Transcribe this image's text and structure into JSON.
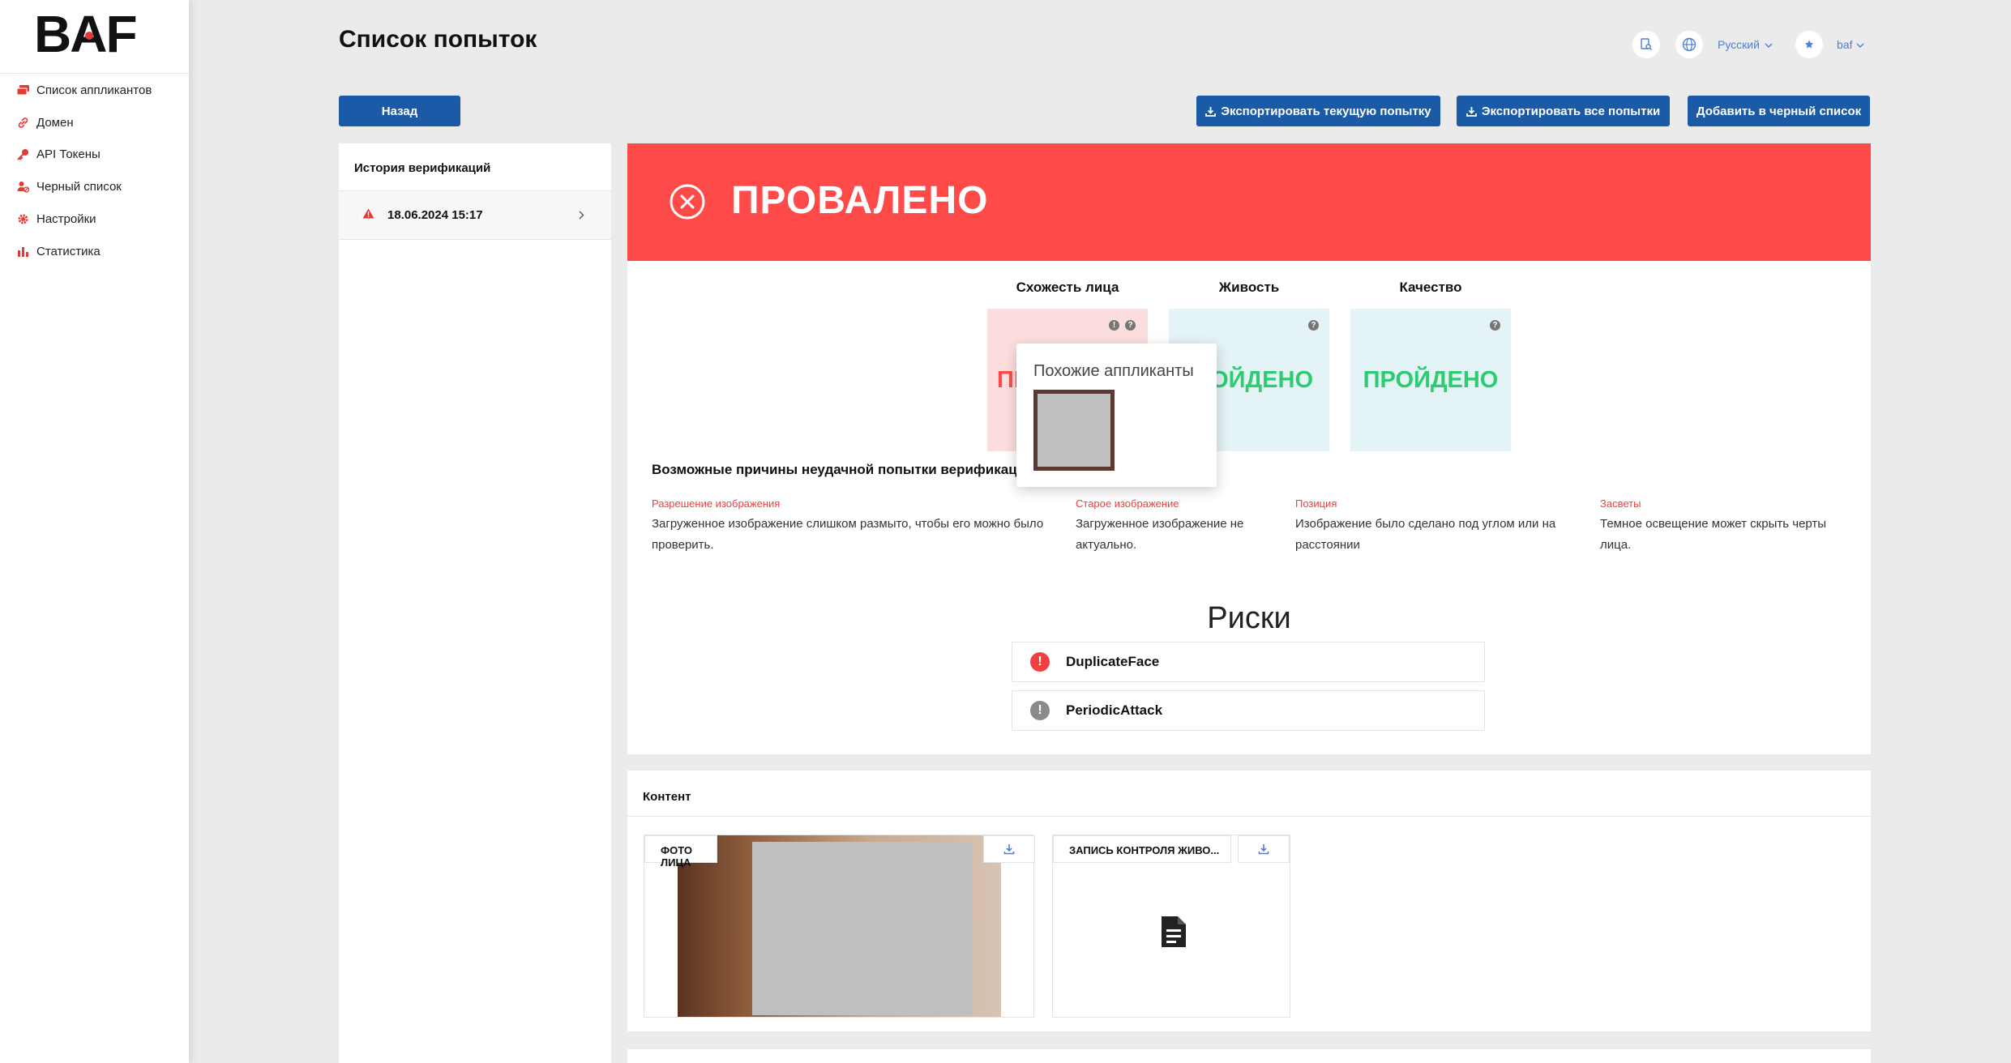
{
  "app": {
    "logo_text": "BAF"
  },
  "sidebar": {
    "items": [
      {
        "label": "Список аппликантов",
        "icon": "cards-icon"
      },
      {
        "label": "Домен",
        "icon": "link-icon"
      },
      {
        "label": "API Токены",
        "icon": "key-icon"
      },
      {
        "label": "Черный список",
        "icon": "user-block-icon"
      },
      {
        "label": "Настройки",
        "icon": "gear-icon"
      },
      {
        "label": "Статистика",
        "icon": "bar-chart-icon"
      }
    ]
  },
  "header": {
    "title": "Список попыток",
    "language": "Русский",
    "user": "baf"
  },
  "actions": {
    "back": "Назад",
    "export_current": "Экспортировать текущую попытку",
    "export_all": "Экспортировать все попытки",
    "blacklist": "Добавить в черный список"
  },
  "history": {
    "title": "История верификаций",
    "items": [
      {
        "date": "18.06.2024 15:17"
      }
    ]
  },
  "result": {
    "status": "ПРОВАЛЕНО",
    "colors": {
      "fail": "#ff4a4a",
      "pass": "#2ecc71"
    },
    "metrics": [
      {
        "title": "Схожесть лица",
        "status": "ПРОВАЛЕНО",
        "visible_status": "ПР"
      },
      {
        "title": "Живость",
        "status": "ПРОЙДЕНО",
        "visible_status": "ОЙДЕНО"
      },
      {
        "title": "Качество",
        "status": "ПРОЙДЕНО"
      }
    ],
    "popup": {
      "title": "Похожие аппликанты"
    }
  },
  "reasons": {
    "title": "Возможные причины неудачной попытки верификации",
    "items": [
      {
        "label": "Разрешение изображения",
        "text": "Загруженное изображение слишком размыто, чтобы его можно было проверить."
      },
      {
        "label": "Старое изображение",
        "text": "Загруженное изображение не актуально."
      },
      {
        "label": "Позиция",
        "text": "Изображение было сделано под углом или на расстоянии"
      },
      {
        "label": "Засветы",
        "text": "Темное освещение может скрыть черты лица."
      }
    ]
  },
  "risks": {
    "title": "Риски",
    "items": [
      {
        "label": "DuplicateFace",
        "color": "#f04040"
      },
      {
        "label": "PeriodicAttack",
        "color": "#8a8a8a"
      }
    ]
  },
  "content": {
    "title": "Контент",
    "face_photo_label": "ФОТО ЛИЦА",
    "liveness_label": "ЗАПИСЬ КОНТРОЛЯ ЖИВО..."
  }
}
